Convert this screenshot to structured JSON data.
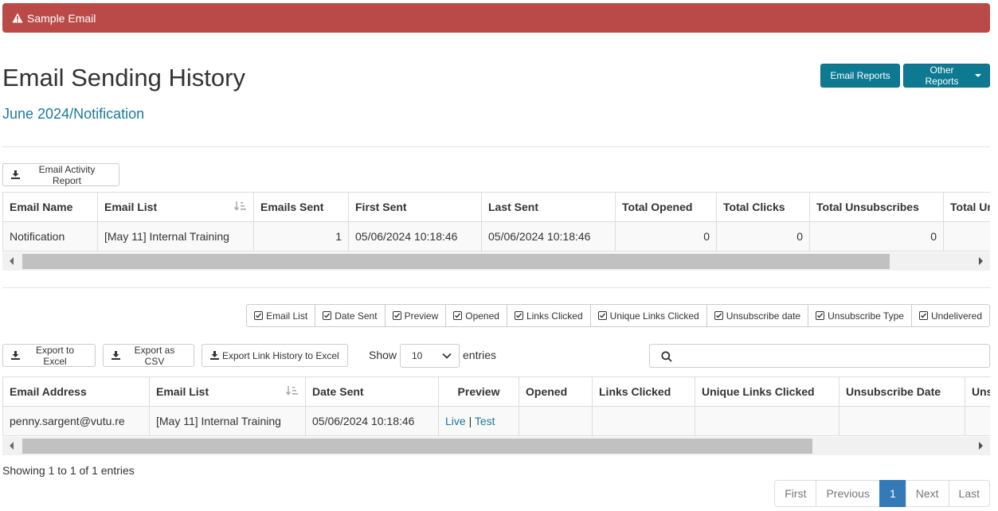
{
  "alert": {
    "text": "Sample Email",
    "icon": "warning-icon",
    "color": "#b94a48"
  },
  "header": {
    "title": "Email Sending History",
    "subtitle": "June 2024/Notification",
    "email_reports_label": "Email Reports",
    "other_reports_label": "Other Reports",
    "accent": "#0d7a92"
  },
  "summary": {
    "export_label": "Email Activity Report",
    "columns": [
      "Email Name",
      "Email List",
      "Emails Sent",
      "First Sent",
      "Last Sent",
      "Total Opened",
      "Total Clicks",
      "Total Unsubscribes",
      "Total Undelivered"
    ],
    "rows": [
      [
        "Notification",
        "[May 11] Internal Training",
        "1",
        "05/06/2024 10:18:46",
        "05/06/2024 10:18:46",
        "0",
        "0",
        "0",
        ""
      ]
    ]
  },
  "column_toggles": [
    "Email List",
    "Date Sent",
    "Preview",
    "Opened",
    "Links Clicked",
    "Unique Links Clicked",
    "Unsubscribe date",
    "Unsubscribe Type",
    "Undelivered"
  ],
  "toolbar": {
    "export_excel": "Export to Excel",
    "export_csv": "Export as CSV",
    "export_link_history": "Export Link History to Excel",
    "show_label": "Show",
    "page_length": "10",
    "entries_label": "entries",
    "search_value": ""
  },
  "detail": {
    "columns": [
      "Email Address",
      "Email List",
      "Date Sent",
      "Preview",
      "Opened",
      "Links Clicked",
      "Unique Links Clicked",
      "Unsubscribe Date",
      "Unsubscribe Type"
    ],
    "rows": [
      {
        "email": "penny.sargent@vutu.re",
        "list": "[May 11] Internal Training",
        "date_sent": "05/06/2024 10:18:46",
        "preview_live": "Live",
        "preview_sep": "|",
        "preview_test": "Test",
        "opened": "",
        "links_clicked": "",
        "unique_links_clicked": "",
        "unsubscribe_date": "",
        "unsubscribe_type": ""
      }
    ]
  },
  "footer": {
    "info": "Showing 1 to 1 of 1 entries",
    "pagination": [
      "First",
      "Previous",
      "1",
      "Next",
      "Last"
    ],
    "active_page": "1",
    "active_color": "#337ab7"
  }
}
